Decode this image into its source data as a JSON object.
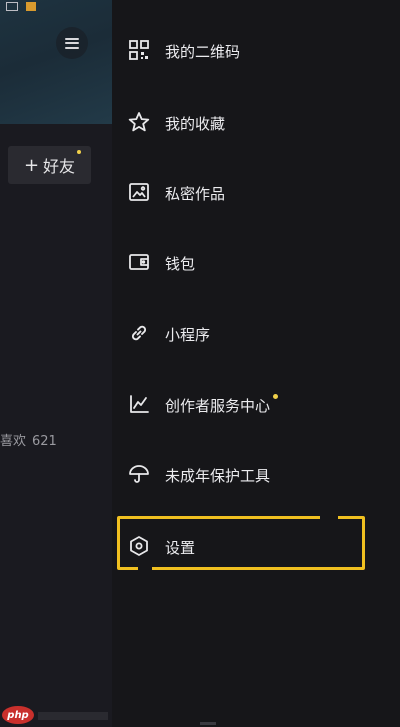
{
  "profile": {
    "add_friend_label": "好友",
    "likes_label": "喜欢",
    "likes_count": "621"
  },
  "drawer": {
    "items": [
      {
        "label": "我的二维码",
        "icon": "qr-code-icon"
      },
      {
        "label": "我的收藏",
        "icon": "star-icon"
      },
      {
        "label": "私密作品",
        "icon": "private-works-icon"
      },
      {
        "label": "钱包",
        "icon": "wallet-icon"
      },
      {
        "label": "小程序",
        "icon": "link-icon"
      },
      {
        "label": "创作者服务中心",
        "icon": "chart-line-icon",
        "has_new_dot": true
      },
      {
        "label": "未成年保护工具",
        "icon": "umbrella-icon"
      },
      {
        "label": "设置",
        "icon": "settings-hexagon-icon",
        "highlighted": true
      }
    ]
  },
  "watermark": {
    "text": "php"
  },
  "colors": {
    "background": "#16161b",
    "accent_dot": "#f0d04a",
    "highlight_border": "#f0c020"
  }
}
